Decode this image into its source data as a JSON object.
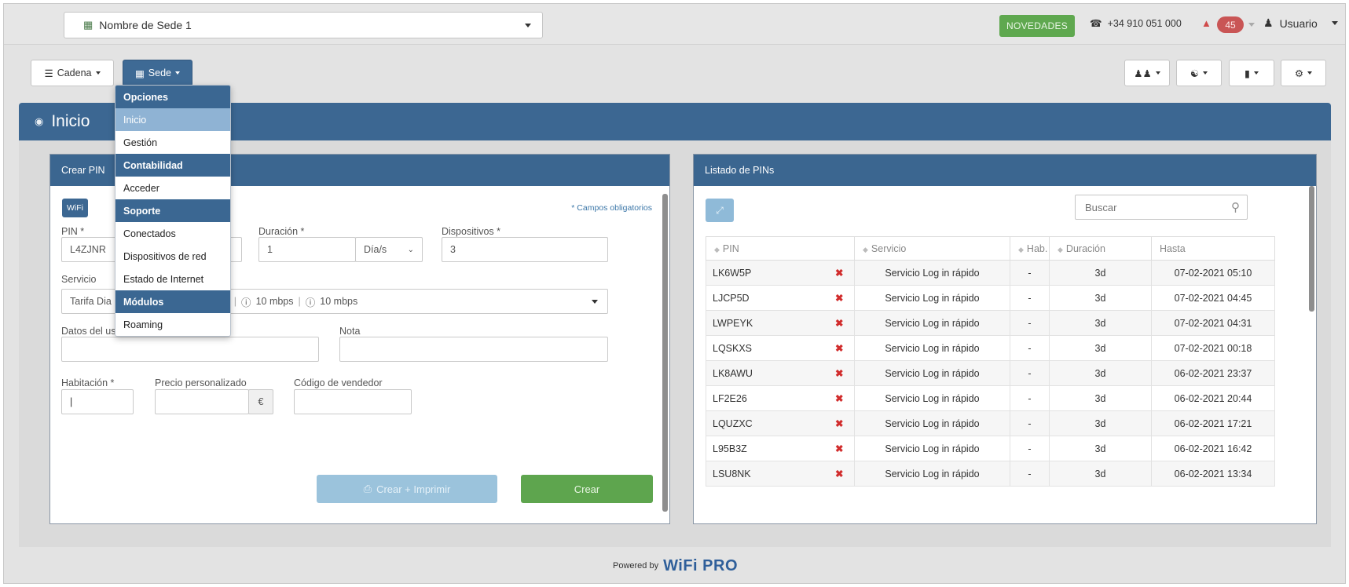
{
  "topbar": {
    "site_name": "Nombre de Sede 1",
    "news_label": "NOVEDADES",
    "phone": "+34 910 051 000",
    "alerts_count": "45",
    "user_label": "Usuario"
  },
  "toolbar": {
    "cadena_label": "Cadena",
    "sede_label": "Sede"
  },
  "sede_menu": [
    {
      "label": "Opciones",
      "kind": "group"
    },
    {
      "label": "Inicio",
      "kind": "active"
    },
    {
      "label": "Gestión",
      "kind": "item"
    },
    {
      "label": "Contabilidad",
      "kind": "group"
    },
    {
      "label": "Acceder",
      "kind": "item"
    },
    {
      "label": "Soporte",
      "kind": "group"
    },
    {
      "label": "Conectados",
      "kind": "item"
    },
    {
      "label": "Dispositivos de red",
      "kind": "item"
    },
    {
      "label": "Estado de Internet",
      "kind": "item"
    },
    {
      "label": "Módulos",
      "kind": "group"
    },
    {
      "label": "Roaming",
      "kind": "item"
    }
  ],
  "page": {
    "title": "Inicio"
  },
  "create_pin": {
    "panel_title": "Crear PIN",
    "wifi_tag": "WiFi",
    "required_note": "* Campos obligatorios",
    "pin_label": "PIN *",
    "pin_value": "L4ZJNR",
    "duration_label": "Duración *",
    "duration_value": "1",
    "duration_unit": "Día/s",
    "devices_label": "Dispositivos *",
    "devices_value": "3",
    "service_label": "Servicio",
    "service_value": "Tarifa Dia",
    "service_speed_down": "10 mbps",
    "service_speed_up": "10 mbps",
    "user_data_label": "Datos del usuario",
    "note_label": "Nota",
    "room_label": "Habitación *",
    "custom_price_label": "Precio personalizado",
    "currency": "€",
    "seller_code_label": "Código de vendedor",
    "create_print_label": "Crear + Imprimir",
    "create_label": "Crear"
  },
  "pin_list": {
    "panel_title": "Listado de PINs",
    "search_placeholder": "Buscar",
    "columns": [
      "PIN",
      "Servicio",
      "Hab.",
      "Duración",
      "Hasta"
    ],
    "rows": [
      {
        "pin": "LK6W5P",
        "service": "Servicio Log in rápido",
        "room": "-",
        "duration": "3d",
        "until": "07-02-2021 05:10"
      },
      {
        "pin": "LJCP5D",
        "service": "Servicio Log in rápido",
        "room": "-",
        "duration": "3d",
        "until": "07-02-2021 04:45"
      },
      {
        "pin": "LWPEYK",
        "service": "Servicio Log in rápido",
        "room": "-",
        "duration": "3d",
        "until": "07-02-2021 04:31"
      },
      {
        "pin": "LQSKXS",
        "service": "Servicio Log in rápido",
        "room": "-",
        "duration": "3d",
        "until": "07-02-2021 00:18"
      },
      {
        "pin": "LK8AWU",
        "service": "Servicio Log in rápido",
        "room": "-",
        "duration": "3d",
        "until": "06-02-2021 23:37"
      },
      {
        "pin": "LF2E26",
        "service": "Servicio Log in rápido",
        "room": "-",
        "duration": "3d",
        "until": "06-02-2021 20:44"
      },
      {
        "pin": "LQUZXC",
        "service": "Servicio Log in rápido",
        "room": "-",
        "duration": "3d",
        "until": "06-02-2021 17:21"
      },
      {
        "pin": "L95B3Z",
        "service": "Servicio Log in rápido",
        "room": "-",
        "duration": "3d",
        "until": "06-02-2021 16:42"
      },
      {
        "pin": "LSU8NK",
        "service": "Servicio Log in rápido",
        "room": "-",
        "duration": "3d",
        "until": "06-02-2021 13:34"
      }
    ]
  },
  "footer": {
    "powered_by": "Powered by",
    "brand": "WiFi PRO"
  },
  "colors": {
    "primary": "#3c6792",
    "success": "#5ea54e",
    "danger": "#c95555"
  }
}
